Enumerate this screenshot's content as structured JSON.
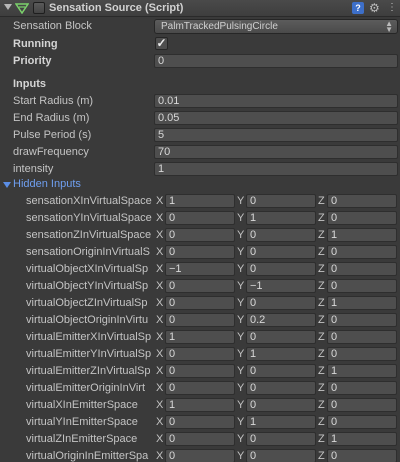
{
  "header": {
    "title": "Sensation Source (Script)",
    "icons": [
      "foldout-arrow-icon",
      "script-icon",
      "help-icon",
      "gear-icon",
      "context-menu-icon"
    ]
  },
  "properties": {
    "sensation_block_label": "Sensation Block",
    "sensation_block_value": "PalmTrackedPulsingCircle",
    "running_label": "Running",
    "running_checked": true,
    "priority_label": "Priority",
    "priority_value": "0"
  },
  "inputs": {
    "heading": "Inputs",
    "fields": [
      {
        "label": "Start Radius (m)",
        "value": "0.01"
      },
      {
        "label": "End Radius (m)",
        "value": "0.05"
      },
      {
        "label": "Pulse Period (s)",
        "value": "5"
      },
      {
        "label": "drawFrequency",
        "value": "70"
      },
      {
        "label": "intensity",
        "value": "1"
      }
    ]
  },
  "hidden_inputs": {
    "heading": "Hidden Inputs",
    "axis_labels": [
      "X",
      "Y",
      "Z"
    ],
    "rows": [
      {
        "label": "sensationXInVirtualSpace",
        "x": "1",
        "y": "0",
        "z": "0"
      },
      {
        "label": "sensationYInVirtualSpace",
        "x": "0",
        "y": "1",
        "z": "0"
      },
      {
        "label": "sensationZInVirtualSpace",
        "x": "0",
        "y": "0",
        "z": "1"
      },
      {
        "label": "sensationOriginInVirtualS",
        "x": "0",
        "y": "0",
        "z": "0"
      },
      {
        "label": "virtualObjectXInVirtualSp",
        "x": "−1",
        "y": "0",
        "z": "0"
      },
      {
        "label": "virtualObjectYInVirtualSp",
        "x": "0",
        "y": "−1",
        "z": "0"
      },
      {
        "label": "virtualObjectZInVirtualSp",
        "x": "0",
        "y": "0",
        "z": "1"
      },
      {
        "label": "virtualObjectOriginInVirtu",
        "x": "0",
        "y": "0.2",
        "z": "0"
      },
      {
        "label": "virtualEmitterXInVirtualSp",
        "x": "1",
        "y": "0",
        "z": "0"
      },
      {
        "label": "virtualEmitterYInVirtualSp",
        "x": "0",
        "y": "1",
        "z": "0"
      },
      {
        "label": "virtualEmitterZInVirtualSp",
        "x": "0",
        "y": "0",
        "z": "1"
      },
      {
        "label": "virtualEmitterOriginInVirt",
        "x": "0",
        "y": "0",
        "z": "0"
      },
      {
        "label": "virtualXInEmitterSpace",
        "x": "1",
        "y": "0",
        "z": "0"
      },
      {
        "label": "virtualYInEmitterSpace",
        "x": "0",
        "y": "1",
        "z": "0"
      },
      {
        "label": "virtualZInEmitterSpace",
        "x": "0",
        "y": "0",
        "z": "1"
      },
      {
        "label": "virtualOriginInEmitterSpa",
        "x": "0",
        "y": "0",
        "z": "0"
      }
    ]
  },
  "colors": {
    "background": "#3a3a3a",
    "field_background": "#4e4e4e",
    "foldout_accent": "#6f9ff0"
  }
}
